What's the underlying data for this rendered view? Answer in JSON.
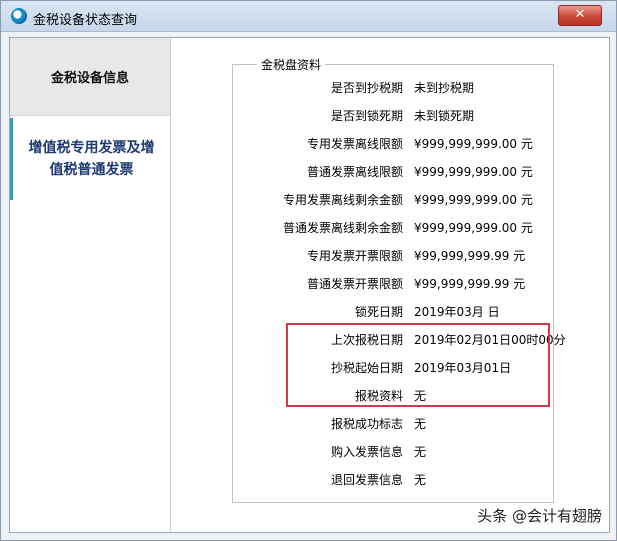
{
  "window": {
    "title": "金税设备状态查询",
    "close_label": "✕"
  },
  "sidebar": {
    "items": [
      {
        "label": "金税设备信息"
      },
      {
        "label_line1": "增值税专用发票及增",
        "label_line2": "值税普通发票"
      }
    ]
  },
  "panel": {
    "group_title": "金税盘资料",
    "rows": [
      {
        "label": "是否到抄税期",
        "value": "未到抄税期"
      },
      {
        "label": "是否到锁死期",
        "value": "未到锁死期"
      },
      {
        "label": "专用发票离线限额",
        "value": "¥999,999,999.00 元"
      },
      {
        "label": "普通发票离线限额",
        "value": "¥999,999,999.00 元"
      },
      {
        "label": "专用发票离线剩余金额",
        "value": "¥999,999,999.00 元"
      },
      {
        "label": "普通发票离线剩余金额",
        "value": "¥999,999,999.00 元"
      },
      {
        "label": "专用发票开票限额",
        "value": "¥99,999,999.99 元"
      },
      {
        "label": "普通发票开票限额",
        "value": "¥99,999,999.99 元"
      },
      {
        "label": "锁死日期",
        "value": "2019年03月  日"
      },
      {
        "label": "上次报税日期",
        "value": "2019年02月01日00时00分"
      },
      {
        "label": "抄税起始日期",
        "value": "2019年03月01日"
      },
      {
        "label": "报税资料",
        "value": "无"
      },
      {
        "label": "报税成功标志",
        "value": "无"
      },
      {
        "label": "购入发票信息",
        "value": "无"
      },
      {
        "label": "退回发票信息",
        "value": "无"
      }
    ]
  },
  "watermark": "头条 @会计有翅膀",
  "colors": {
    "highlight_border": "#d03a4a",
    "active_nav_text": "#1f3a73",
    "active_nav_bar": "#2f9fb3"
  }
}
